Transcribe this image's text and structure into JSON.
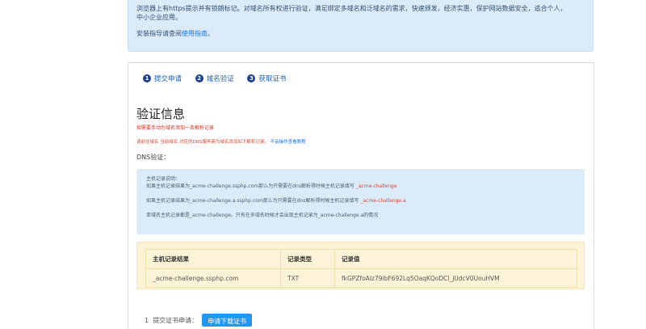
{
  "info": {
    "line1": "浏览器上有https提示并有锁朗标记。对域名所有权进行验证，满足绑定多域名和泛域名的需求，快速颁发，经济实惠，保护网站数据安全，适合个人，",
    "line2": "中小企业应用。",
    "guide_prefix": "安装指导请查阅",
    "guide_link": "使用指南",
    "guide_suffix": "。"
  },
  "steps": [
    {
      "num": "1",
      "label": "提交申请"
    },
    {
      "num": "2",
      "label": "域名验证"
    },
    {
      "num": "3",
      "label": "获取证书"
    }
  ],
  "main": {
    "title": "验证信息",
    "warning": "如需要手动为域名添加一条解析记录",
    "note": "请前往域名 当前域名 对应的DNS服务商为域名添加如下解析记录。",
    "note_link": "不会操作查看教程",
    "dns_label": "DNS验证："
  },
  "description": {
    "heading": "主机记录说明：",
    "line1_prefix": "如果主机记录结果为_acme-challenge.ssphp.com那么为只需要在dns解析得时候主机记录填写",
    "line1_value": "_acme-challenge",
    "line2_prefix": "如果主机记录结果为_acme-challenge.a.ssphp.com那么为只需要在dns解析得时候主机记录填写",
    "line2_value": "_acme-challenge.a",
    "line3": "单域名主机记录都是_acme-challenge。只有在多域名时候才会出现主机记录为_acme-challenge.a的情况"
  },
  "table": {
    "headers": [
      "主机记录结果",
      "记录类型",
      "记录值"
    ],
    "rows": [
      [
        "_acme-challenge.ssphp.com",
        "TXT",
        "fkGPZfoAIz79ibF692Lq5OaqKQoDCl_jUdcV0UouHVM"
      ]
    ]
  },
  "bottom": {
    "num": "1",
    "label": "提交证书申请：",
    "button": "申请下载证书"
  }
}
